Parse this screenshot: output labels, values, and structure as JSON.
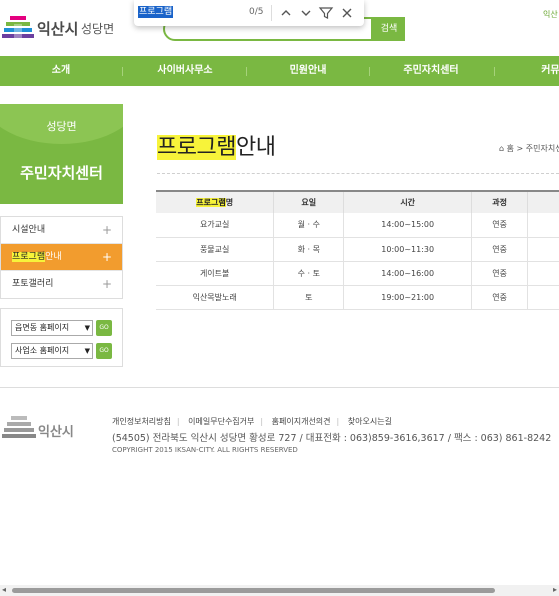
{
  "header": {
    "city": "익산시",
    "town": "성당면",
    "search_button": "검색",
    "top_right": "익산"
  },
  "findbar": {
    "query": "프로그램",
    "count": "0/5"
  },
  "nav": {
    "items": [
      "소개",
      "사이버사무소",
      "민원안내",
      "주민자치센터",
      "커뮤니"
    ]
  },
  "sidebar": {
    "sub_title": "성당면",
    "main_title": "주민자치센터",
    "items": [
      {
        "label": "시설안내",
        "highlight": "",
        "rest": "시설안내"
      },
      {
        "label": "프로그램안내",
        "highlight": "프로그램",
        "rest": "안내"
      },
      {
        "label": "포토갤러리",
        "highlight": "",
        "rest": "포토갤러리"
      }
    ],
    "selects": [
      "읍면동 홈페이지",
      "사업소 홈페이지"
    ],
    "go_label": "GO"
  },
  "content": {
    "title_highlight": "프로그램",
    "title_rest": "안내",
    "breadcrumb": "⌂ 홈 > 주민자치센",
    "table": {
      "headers": [
        {
          "highlight": "프로그램",
          "rest": "명"
        },
        {
          "highlight": "",
          "rest": "요일"
        },
        {
          "highlight": "",
          "rest": "시간"
        },
        {
          "highlight": "",
          "rest": "과정"
        },
        {
          "highlight": "",
          "rest": ""
        }
      ],
      "rows": [
        [
          "요가교실",
          "월 · 수",
          "14:00~15:00",
          "연중",
          ""
        ],
        [
          "풍물교실",
          "화 · 목",
          "10:00~11:30",
          "연중",
          ""
        ],
        [
          "게이트볼",
          "수 · 토",
          "14:00~16:00",
          "연중",
          ""
        ],
        [
          "익산목발노래",
          "토",
          "19:00~21:00",
          "연중",
          ""
        ]
      ]
    }
  },
  "footer": {
    "city": "익산시",
    "links": [
      "개인정보처리방침",
      "이메일무단수집거부",
      "홈페이지개선의견",
      "찾아오시는길"
    ],
    "address": "(54505) 전라북도 익산시 성당면 황성로 727 / 대표전화 : 063)859-3616,3617 / 팩스 : 063) 861-8242",
    "copyright": "COPYRIGHT 2015 IKSAN-CITY. ALL RIGHTS RESERVED"
  },
  "colors": {
    "brand_green": "#7ab842",
    "active_orange": "#f29c2e",
    "find_highlight": "#f7f33a"
  }
}
